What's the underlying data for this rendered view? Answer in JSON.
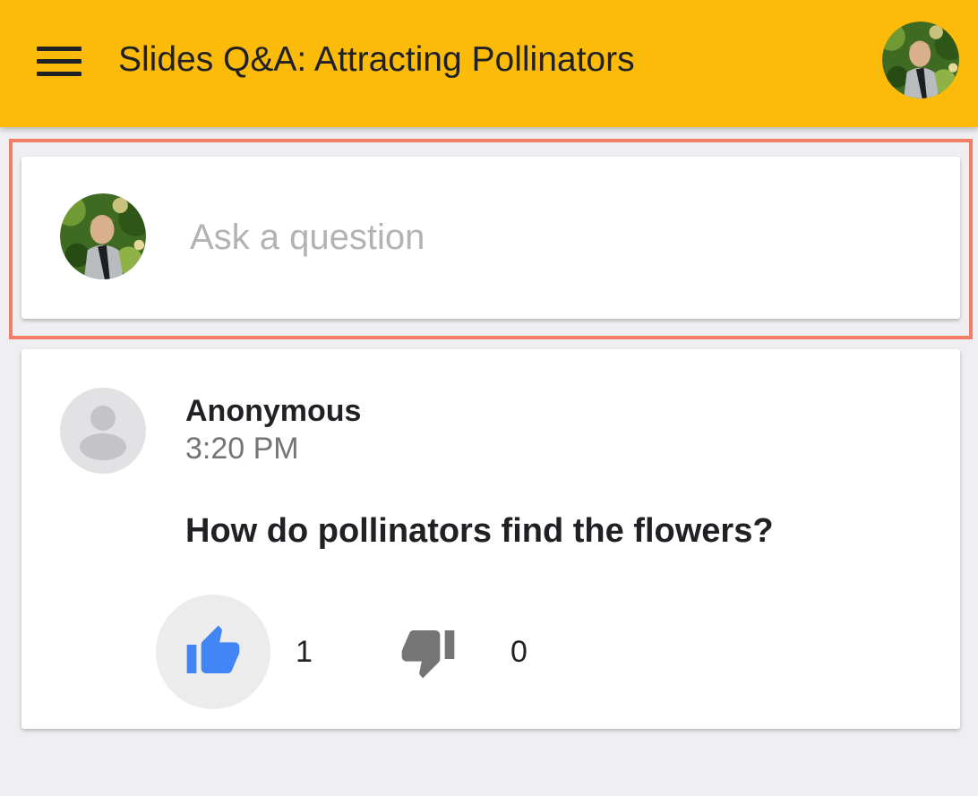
{
  "app_bar": {
    "title": "Slides Q&A: Attracting Pollinators",
    "menu_icon": "hamburger-menu-icon",
    "account_icon": "user-photo-avatar",
    "color": "#fbbb08"
  },
  "composer": {
    "placeholder": "Ask a question",
    "avatar_icon": "user-photo-avatar",
    "highlight_color": "#f47e65"
  },
  "question": {
    "author": "Anonymous",
    "time": "3:20 PM",
    "text": "How do pollinators find the flowers?",
    "upvote": {
      "icon": "thumb-up-icon",
      "count": "1",
      "selected": true,
      "color": "#4285f4"
    },
    "downvote": {
      "icon": "thumb-down-icon",
      "count": "0",
      "selected": false,
      "color": "#757575"
    }
  }
}
